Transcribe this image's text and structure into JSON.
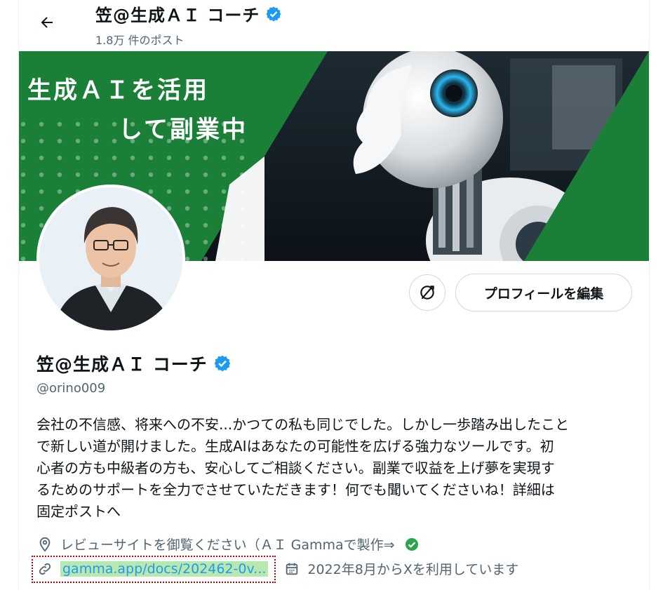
{
  "header": {
    "back_icon": "arrow-left-icon",
    "name": "笠@生成ＡＩ コーチ",
    "post_count": "1.8万 件のポスト",
    "verified_icon": "verified-badge-icon",
    "verified_color": "#1d9bf0"
  },
  "banner": {
    "line1": "生成ＡＩを活用",
    "line2": "して副業中",
    "brand_color": "#1a7f37",
    "image_description_icon": "robot-icon"
  },
  "actions": {
    "icon_button_icon": "no-refresh-icon",
    "edit_label": "プロフィールを編集"
  },
  "profile": {
    "name": "笠@生成ＡＩ コーチ",
    "handle": "@orino009",
    "bio": "会社の不信感、将来への不安...かつての私も同じでした。しかし一歩踏み出したこと\nで新しい道が開けました。生成AIはあなたの可能性を広げる強力なツールです。初\n心者の方も中級者の方も、安心してご相談ください。副業で収益を上げ夢を実現す\nるためのサポートを全力でさせていただきます！何でも聞いてくださいね！詳細は\n固定ポストへ",
    "location": "レビューサイトを御覧ください（ＡＩ Gammaで製作⇒",
    "location_icon": "location-pin-icon",
    "location_check_icon": "green-check-icon",
    "link": "gamma.app/docs/202462-0v...",
    "link_icon": "link-icon",
    "joined": "2022年8月からXを利用しています",
    "joined_icon": "calendar-icon",
    "link_color": "#1d9bf0",
    "muted_color": "#536471"
  }
}
